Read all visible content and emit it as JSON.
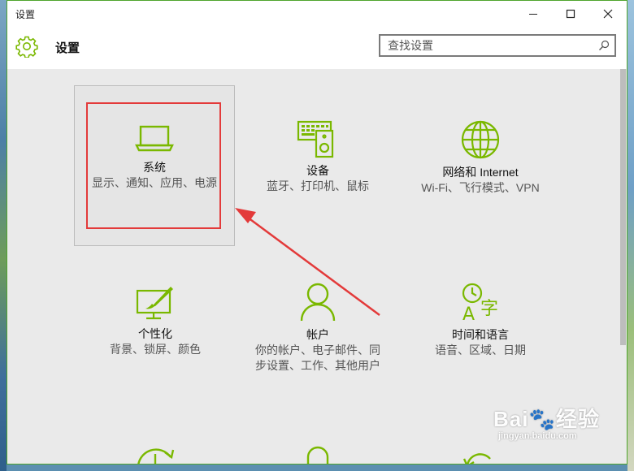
{
  "window": {
    "title": "设置"
  },
  "header": {
    "title": "设置"
  },
  "search": {
    "placeholder": "查找设置"
  },
  "tiles": [
    {
      "name": "系统",
      "desc": "显示、通知、应用、电源",
      "icon": "laptop-icon"
    },
    {
      "name": "设备",
      "desc": "蓝牙、打印机、鼠标",
      "icon": "devices-icon"
    },
    {
      "name": "网络和 Internet",
      "desc": "Wi-Fi、飞行模式、VPN",
      "icon": "globe-icon"
    },
    {
      "name": "个性化",
      "desc": "背景、锁屏、颜色",
      "icon": "paintbrush-icon"
    },
    {
      "name": "帐户",
      "desc": "你的帐户、电子邮件、同步设置、工作、其他用户",
      "icon": "person-icon"
    },
    {
      "name": "时间和语言",
      "desc": "语音、区域、日期",
      "icon": "time-language-icon"
    }
  ],
  "accent_color": "#7ab800",
  "annotation_color": "#e33a3a",
  "watermark": {
    "main": "Bai🐾经验",
    "sub": "jingyan.baidu.com"
  }
}
